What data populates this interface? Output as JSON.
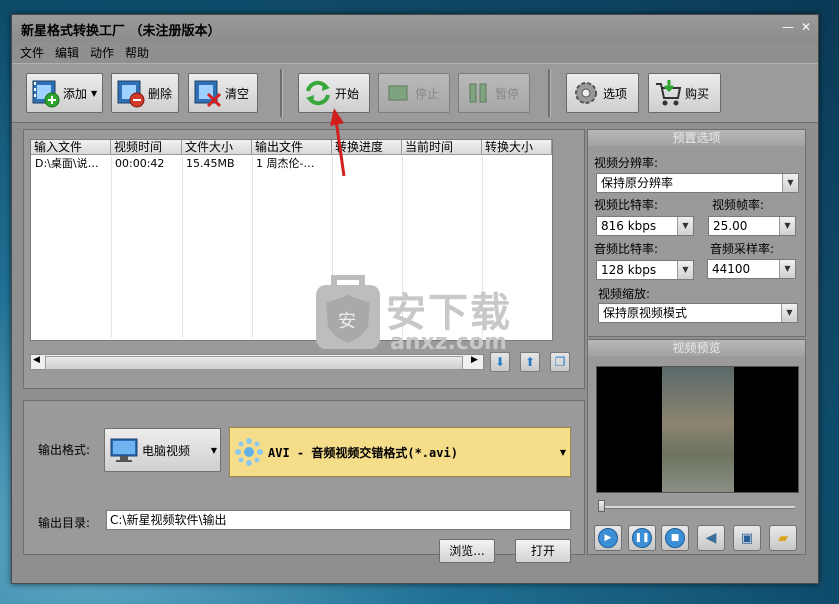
{
  "window": {
    "title": "新星格式转换工厂 （未注册版本）",
    "controls": {
      "minimize": "—",
      "close": "✕"
    }
  },
  "menu": [
    "文件",
    "编辑",
    "动作",
    "帮助"
  ],
  "toolbar": {
    "add": "添加",
    "delete": "删除",
    "clear": "清空",
    "start": "开始",
    "stop": "停止",
    "pause": "暂停",
    "options": "选项",
    "buy": "购买"
  },
  "table": {
    "columns": [
      "输入文件",
      "视频时间",
      "文件大小",
      "输出文件",
      "转换进度",
      "当前时间",
      "转换大小"
    ],
    "rows": [
      [
        "D:\\桌面\\说…",
        "00:00:42",
        "15.45MB",
        "1 周杰伦-…",
        "",
        "",
        ""
      ]
    ]
  },
  "output": {
    "format_label": "输出格式:",
    "category": "电脑视频",
    "format": "AVI - 音频视频交错格式(*.avi)",
    "dir_label": "输出目录:",
    "dir_value": "C:\\新星视频软件\\输出",
    "browse": "浏览...",
    "open": "打开"
  },
  "presets": {
    "header": "预置选项",
    "resolution_label": "视频分辨率:",
    "resolution_value": "保持原分辨率",
    "vbitrate_label": "视频比特率:",
    "vbitrate_value": "816 kbps",
    "framerate_label": "视频帧率:",
    "framerate_value": "25.00",
    "abitrate_label": "音频比特率:",
    "abitrate_value": "128 kbps",
    "samplerate_label": "音频采样率:",
    "samplerate_value": "44100",
    "scale_label": "视频缩放:",
    "scale_value": "保持原视频模式"
  },
  "preview": {
    "header": "视频预览"
  },
  "watermark": {
    "cn": "安下载",
    "en": "anxz.com",
    "shield": "安"
  },
  "colors": {
    "window_bg": "#8f8f8f",
    "format_bar": "#f6dd8a",
    "accent_blue": "#2a7cc7",
    "arrow_red": "#d11f1f"
  }
}
